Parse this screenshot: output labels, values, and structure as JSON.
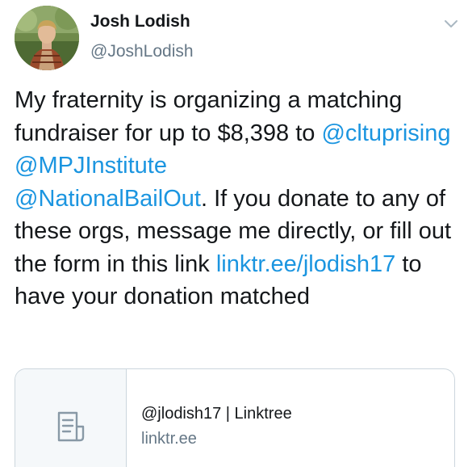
{
  "tweet": {
    "author_name": "Josh Lodish",
    "author_handle": "@JoshLodish",
    "body": {
      "text_1": "My fraternity is organizing a matching fundraiser for up to $8,398 to ",
      "mention_1": "@cltuprising",
      "text_2": " ",
      "mention_2": "@MPJInstitute",
      "text_3": " ",
      "mention_3": "@NationalBailOut",
      "text_4": ". If you donate to any of these orgs, message me directly, or fill out the form in this link ",
      "link": "linktr.ee/jlodish17",
      "text_5": " to have your donation matched"
    },
    "link_card": {
      "title": "@jlodish17 | Linktree",
      "domain": "linktr.ee"
    }
  },
  "icons": {
    "menu": "chevron-down-icon",
    "card_thumbnail": "document-icon",
    "avatar": "profile-photo"
  },
  "colors": {
    "link": "#1b95e0",
    "secondary_text": "#657786",
    "primary_text": "#14171a",
    "border": "#ccd6dd"
  }
}
